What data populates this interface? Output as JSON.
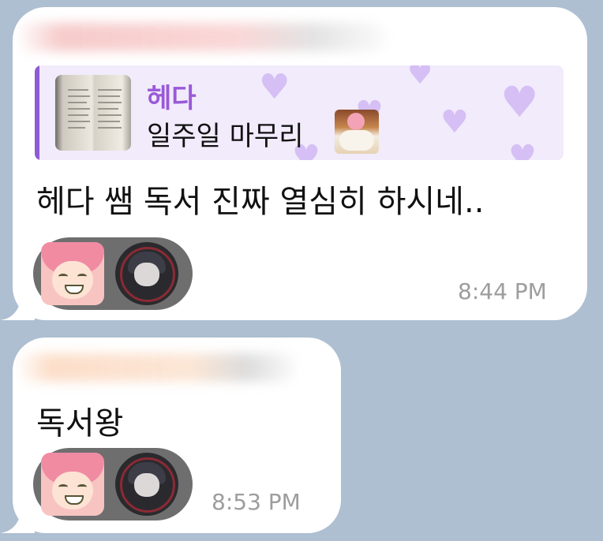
{
  "messages": [
    {
      "reply": {
        "name": "헤다",
        "text": "일주일 마무리"
      },
      "text": "헤다 쌤 독서 진짜 열심히 하시네..",
      "time": "8:44 PM"
    },
    {
      "text": "독서왕",
      "time": "8:53 PM"
    }
  ],
  "colors": {
    "background": "#aebfd1",
    "bubble": "#ffffff",
    "reply_accent": "#8e5bd6",
    "reply_name": "#9a59d8",
    "reply_background": "#f1ebfb",
    "heart": "#d5bff4",
    "reaction_pill": "#6e6e6e",
    "time": "#9d9d9d"
  },
  "icons": {
    "reply_thumbnail": "open-book-photo",
    "sticker": "anime-girl-with-dog-sticker",
    "reaction_avatar_1": "pink-hair-anime-avatar",
    "reaction_avatar_2": "dark-hair-anime-avatar",
    "reply_pattern": "heart-icon"
  }
}
